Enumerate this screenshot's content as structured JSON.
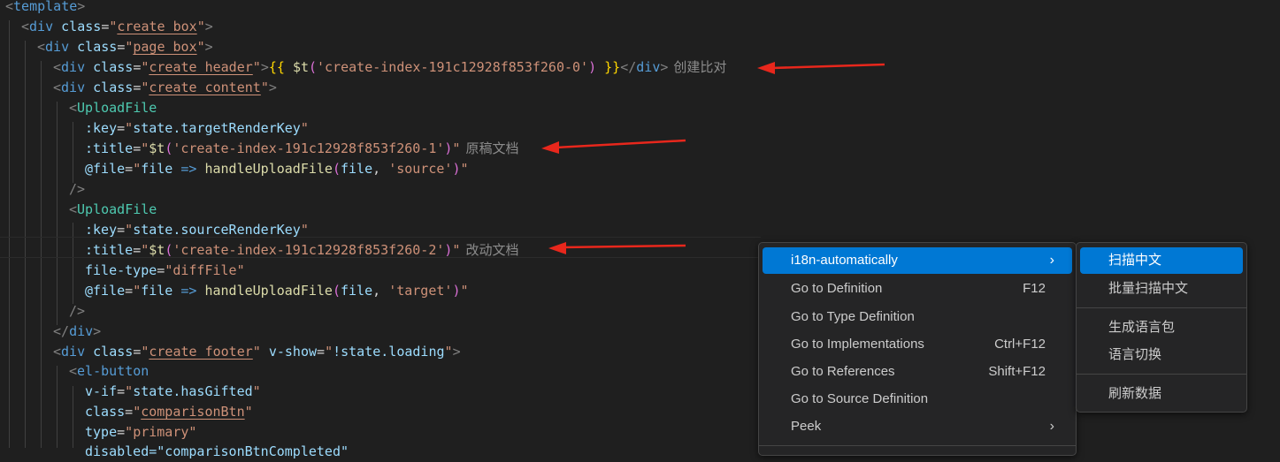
{
  "code": {
    "template_tag": "template",
    "lines": {
      "l2_cls": "create_box",
      "l3_cls": "page_box",
      "l4_cls": "create_header",
      "l4_open": "{{ ",
      "l4_fn": "$t",
      "l4_key": "'create-index-191c12928f853f260-0'",
      "l4_close": " }}",
      "l4_hint": "创建比对",
      "l5_cls": "create_content",
      "upload_comp": "UploadFile",
      "key1_attr": ":key",
      "key1_val": "state.targetRenderKey",
      "title_attr": ":title",
      "title1_key": "'create-index-191c12928f853f260-1'",
      "title1_hint": "原稿文档",
      "file_attr": "@file",
      "file_param": "file",
      "file_arrow": "=>",
      "file_fn": "handleUploadFile",
      "file1_arg": "'source'",
      "key2_val": "state.sourceRenderKey",
      "title2_key": "'create-index-191c12928f853f260-2'",
      "title2_hint": "改动文档",
      "filetype_attr": "file-type",
      "filetype_val": "diffFile",
      "file2_arg": "'target'",
      "div_tag": "div",
      "footer_cls": "create_footer",
      "vshow_attr": "v-show",
      "vshow_val": "!state.loading",
      "elbutton": "el-button",
      "vif_attr": "v-if",
      "vif_val": "state.hasGifted",
      "class_attr": "class",
      "btn_cls": "comparisonBtn",
      "type_attr": "type",
      "type_val": "primary",
      "cut_line": "disabled=\"comparisonBtnCompleted\""
    }
  },
  "context_menu": {
    "items": [
      {
        "label": "i18n-automatically",
        "shortcut": "",
        "has_submenu": true
      },
      {
        "label": "Go to Definition",
        "shortcut": "F12"
      },
      {
        "label": "Go to Type Definition",
        "shortcut": ""
      },
      {
        "label": "Go to Implementations",
        "shortcut": "Ctrl+F12"
      },
      {
        "label": "Go to References",
        "shortcut": "Shift+F12"
      },
      {
        "label": "Go to Source Definition",
        "shortcut": ""
      },
      {
        "label": "Peek",
        "shortcut": "",
        "has_submenu": true
      }
    ],
    "chevron": "›"
  },
  "submenu": {
    "items": [
      {
        "label": "扫描中文"
      },
      {
        "label": "批量扫描中文"
      },
      {
        "label": "生成语言包"
      },
      {
        "label": "语言切换"
      },
      {
        "label": "刷新数据"
      }
    ]
  },
  "colors": {
    "background": "#1f1f1f",
    "menu_background": "#252526",
    "menu_highlight": "#0078d4",
    "annotation_arrow": "#e8271c"
  }
}
